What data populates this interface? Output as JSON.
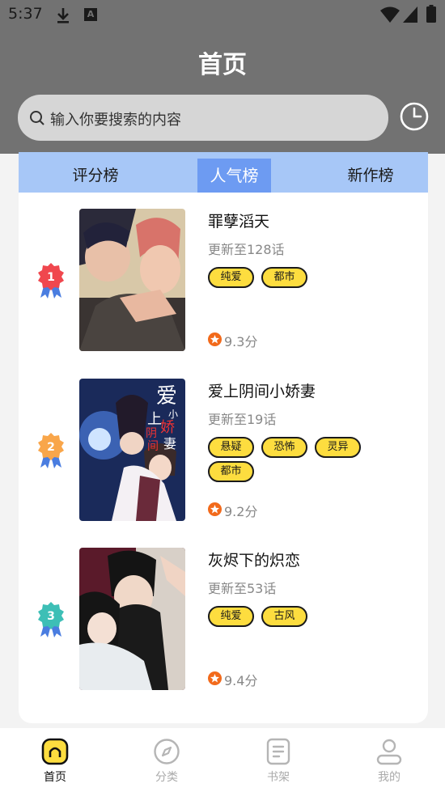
{
  "status_bar": {
    "time": "5:37",
    "a_badge": "A",
    "icons": [
      "download-icon",
      "a-notification-icon",
      "wifi-icon",
      "signal-icon",
      "battery-icon"
    ]
  },
  "header": {
    "title": "首页"
  },
  "search": {
    "placeholder": "输入你要搜索的内容",
    "icon": "search-icon",
    "history_icon": "clock-icon"
  },
  "tabs": [
    {
      "label": "评分榜",
      "active": false
    },
    {
      "label": "人气榜",
      "active": true
    },
    {
      "label": "新作榜",
      "active": false
    }
  ],
  "items": [
    {
      "rank": "1",
      "title": "罪孽滔天",
      "update": "更新至128话",
      "tags": [
        "纯爱",
        "都市"
      ],
      "score": "9.3分",
      "badge_color": "#f0474e"
    },
    {
      "rank": "2",
      "title": "爱上阴间小娇妻",
      "update": "更新至19话",
      "tags": [
        "悬疑",
        "恐怖",
        "灵异",
        "都市"
      ],
      "score": "9.2分",
      "badge_color": "#f9a64a",
      "cover_title_glyphs": [
        "爱",
        "上",
        "小",
        "阴",
        "娇",
        "间",
        "妻"
      ]
    },
    {
      "rank": "3",
      "title": "灰烬下的炽恋",
      "update": "更新至53话",
      "tags": [
        "纯爱",
        "古风"
      ],
      "score": "9.4分",
      "badge_color": "#3dbfb6"
    }
  ],
  "bottom_nav": [
    {
      "label": "首页",
      "icon": "home-icon",
      "active": true
    },
    {
      "label": "分类",
      "icon": "compass-icon",
      "active": false
    },
    {
      "label": "书架",
      "icon": "bookshelf-icon",
      "active": false
    },
    {
      "label": "我的",
      "icon": "profile-icon",
      "active": false
    }
  ],
  "colors": {
    "header_bg": "#727272",
    "tab_bar": "#a7c7f7",
    "tab_active": "#6d9bf2",
    "tag_bg": "#fddd3f",
    "score_icon": "#f26a1b"
  }
}
